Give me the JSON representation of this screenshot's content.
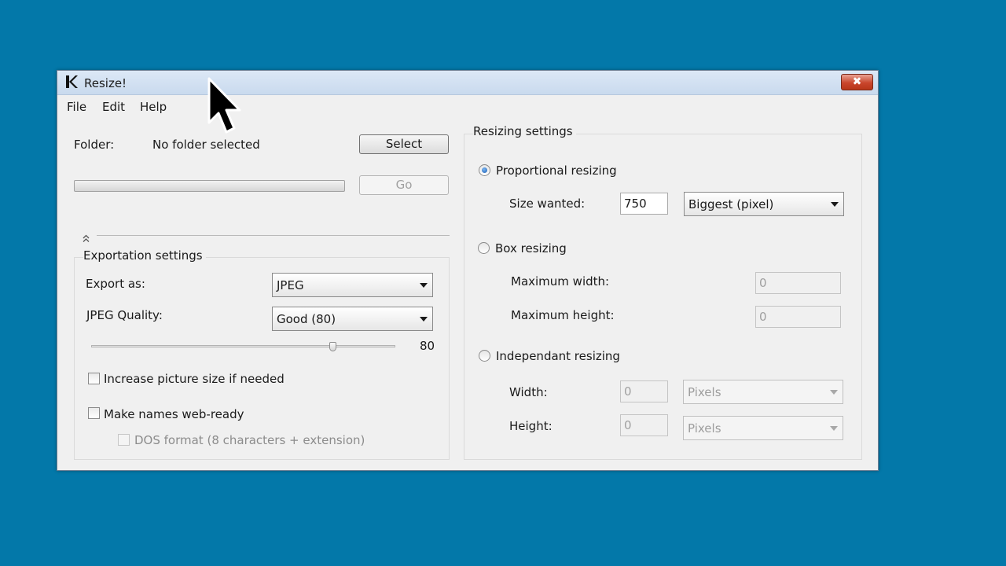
{
  "window": {
    "title": "Resize!",
    "close_glyph": "✖"
  },
  "menu": [
    "File",
    "Edit",
    "Help"
  ],
  "folder": {
    "label": "Folder:",
    "value": "No folder selected",
    "select_button": "Select",
    "go_button": "Go"
  },
  "export": {
    "section_title": "Exportation settings",
    "export_as_label": "Export as:",
    "export_as_value": "JPEG",
    "quality_label": "JPEG Quality:",
    "quality_value": "Good (80)",
    "quality_slider_value": "80",
    "quality_slider_fraction": 0.8,
    "increase_size_label": "Increase picture size if needed",
    "increase_size_checked": false,
    "web_ready_label": "Make names web-ready",
    "web_ready_checked": false,
    "dos_format_label": "DOS format (8 characters + extension)",
    "dos_format_checked": false
  },
  "resizing": {
    "section_title": "Resizing settings",
    "proportional_label": "Proportional resizing",
    "proportional_selected": true,
    "size_wanted_label": "Size wanted:",
    "size_wanted_value": "750",
    "size_mode_value": "Biggest (pixel)",
    "box_label": "Box resizing",
    "box_selected": false,
    "max_width_label": "Maximum width:",
    "max_width_value": "0",
    "max_height_label": "Maximum height:",
    "max_height_value": "0",
    "independant_label": "Independant resizing",
    "independant_selected": false,
    "width_label": "Width:",
    "width_value": "0",
    "width_unit": "Pixels",
    "height_label": "Height:",
    "height_value": "0",
    "height_unit": "Pixels"
  },
  "icons": {
    "app": "k-logo-icon",
    "collapse": "collapse-arrows-icon",
    "cursor": "mouse-pointer-icon",
    "dropdown": "chevron-down-icon"
  }
}
